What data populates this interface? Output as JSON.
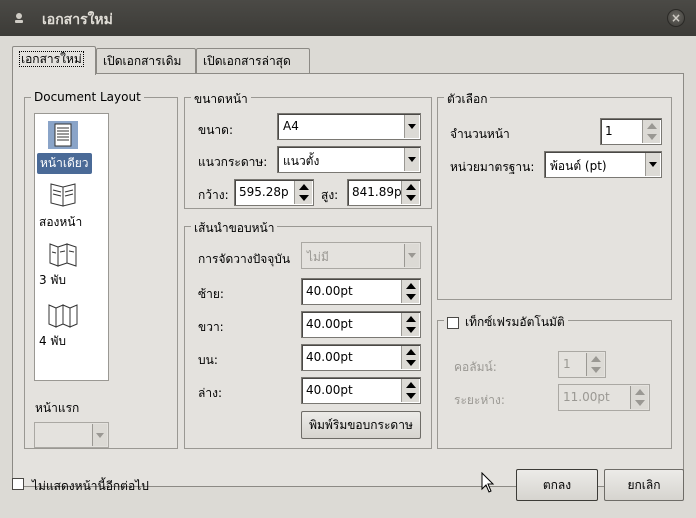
{
  "window": {
    "title": "เอกสารใหม่"
  },
  "tabs": [
    {
      "label": "เอกสารใหม่",
      "active": true
    },
    {
      "label": "เปิดเอกสารเดิม",
      "active": false
    },
    {
      "label": "เปิดเอกสารล่าสุด",
      "active": false
    }
  ],
  "document_layout": {
    "title": "Document Layout",
    "items": [
      {
        "label": "หน้าเดียว",
        "icon": "single-page-icon",
        "selected": true
      },
      {
        "label": "สองหน้า",
        "icon": "double-page-icon",
        "selected": false
      },
      {
        "label": "3 พับ",
        "icon": "three-fold-icon",
        "selected": false
      },
      {
        "label": "4 พับ",
        "icon": "four-fold-icon",
        "selected": false
      }
    ],
    "first_page_label": "หน้าแรก",
    "first_page_value": ""
  },
  "page_size": {
    "title": "ขนาดหน้า",
    "size_label": "ขนาด:",
    "size_value": "A4",
    "orientation_label": "แนวกระดาษ:",
    "orientation_value": "แนวตั้ง",
    "width_label": "กว้าง:",
    "width_value": "595.28p",
    "height_label": "สูง:",
    "height_value": "841.89p"
  },
  "margin_guides": {
    "title": "เส้นนำขอบหน้า",
    "preset_label": "การจัดวางปัจจุบัน",
    "preset_value": "ไม่มี",
    "left_label": "ซ้าย:",
    "left_value": "40.00pt",
    "right_label": "ขวา:",
    "right_value": "40.00pt",
    "top_label": "บน:",
    "top_value": "40.00pt",
    "bottom_label": "ล่าง:",
    "bottom_value": "40.00pt",
    "printer_margins_button": "พิมพ์ริมขอบกระดาษ"
  },
  "options": {
    "title": "ตัวเลือก",
    "pages_label": "จำนวนหน้า",
    "pages_value": "1",
    "unit_label": "หน่วยมาตรฐาน:",
    "unit_value": "พ้อนต์ (pt)"
  },
  "auto_text_frames": {
    "title": "เท็กซ์เฟรมอัตโนมัติ",
    "checked": false,
    "columns_label": "คอลัมน์:",
    "columns_value": "1",
    "gap_label": "ระยะห่าง:",
    "gap_value": "11.00pt"
  },
  "footer": {
    "dont_show_label": "ไม่แสดงหน้านี้อีกต่อไป",
    "ok_button": "ตกลง",
    "cancel_button": "ยกเลิก"
  }
}
